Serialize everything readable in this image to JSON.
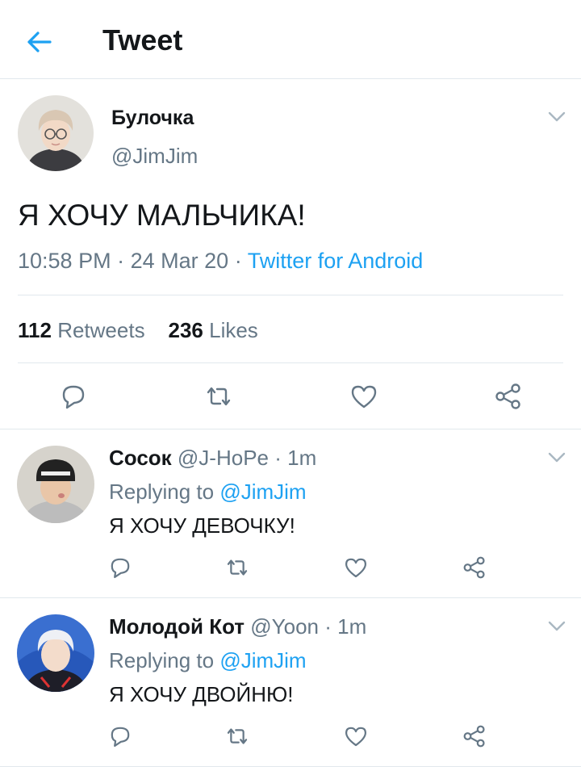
{
  "header": {
    "title": "Tweet",
    "back_icon": "arrow-left-icon",
    "accent_color": "#1da1f2"
  },
  "main_tweet": {
    "display_name": "Булочка",
    "handle": "@JimJim",
    "text": "Я ХОЧУ МАЛЬЧИКА!",
    "time": "10:58 PM",
    "separator": "·",
    "date": "24 Mar 20",
    "source": "Twitter for Android",
    "retweets_count": "112",
    "retweets_label": "Retweets",
    "likes_count": "236",
    "likes_label": "Likes"
  },
  "replies": [
    {
      "display_name": "Сосок",
      "handle": "@J-HoPe",
      "time": "· 1m",
      "replying_label": "Replying to",
      "replying_to": "@JimJim",
      "text": "Я ХОЧУ ДЕВОЧКУ!"
    },
    {
      "display_name": "Молодой Кот",
      "handle": "@Yoon",
      "time": "· 1m",
      "replying_label": "Replying to",
      "replying_to": "@JimJim",
      "text": "Я ХОЧУ ДВОЙНЮ!"
    }
  ],
  "icons": {
    "reply": "reply-icon",
    "retweet": "retweet-icon",
    "like": "heart-icon",
    "share": "share-icon",
    "menu": "chevron-down-icon"
  },
  "colors": {
    "text_primary": "#14171a",
    "text_secondary": "#657786",
    "link": "#1da1f2",
    "divider": "#e1e8ed"
  }
}
